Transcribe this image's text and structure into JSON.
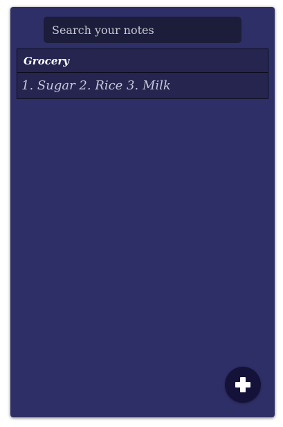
{
  "search": {
    "placeholder": "Search your notes",
    "value": ""
  },
  "notes": [
    {
      "title": "Grocery",
      "body": "1. Sugar 2. Rice 3. Milk"
    }
  ],
  "fab": {
    "icon": "plus-icon"
  },
  "colors": {
    "background": "#2f2f68",
    "search_bg": "#1c1c3b",
    "note_bg": "#25254f",
    "fab_bg": "#15123a"
  }
}
